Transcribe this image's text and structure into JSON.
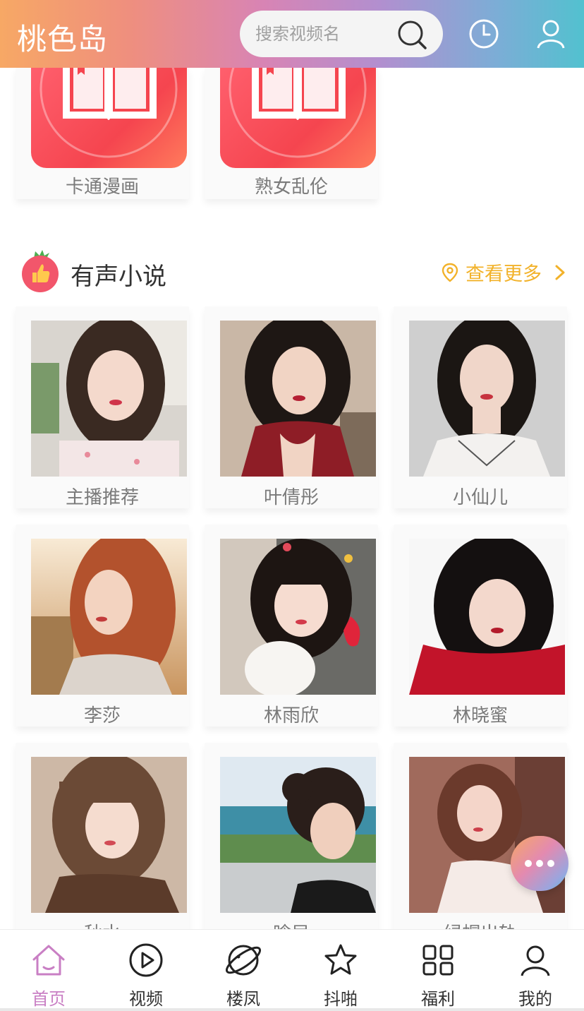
{
  "header": {
    "app_title": "桃色岛",
    "search_placeholder": "搜索视频名",
    "icons": [
      "search-icon",
      "history-clock-icon",
      "user-icon"
    ]
  },
  "categories": [
    {
      "label": "卡通漫画",
      "icon": "open-book-icon",
      "tile_color": "#f5454f"
    },
    {
      "label": "熟女乱伦",
      "icon": "open-book-icon",
      "tile_color": "#f5454f"
    }
  ],
  "section": {
    "title": "有声小说",
    "more_label": "查看更多",
    "icon": "strawberry-thumbs-up-icon",
    "accent_color": "#f2b22a"
  },
  "anchors": [
    {
      "name": "主播推荐"
    },
    {
      "name": "叶倩彤"
    },
    {
      "name": "小仙儿"
    },
    {
      "name": "李莎"
    },
    {
      "name": "林雨欣"
    },
    {
      "name": "林晓蜜"
    },
    {
      "name": "秋水"
    },
    {
      "name": "晗局"
    },
    {
      "name": "绿帽出轨"
    }
  ],
  "fab": {
    "icon": "more-dots-icon"
  },
  "bottom_nav": [
    {
      "label": "首页",
      "icon": "home-icon",
      "active": true
    },
    {
      "label": "视频",
      "icon": "play-circle-icon",
      "active": false
    },
    {
      "label": "楼凤",
      "icon": "planet-icon",
      "active": false
    },
    {
      "label": "抖啪",
      "icon": "star-icon",
      "active": false
    },
    {
      "label": "福利",
      "icon": "grid-icon",
      "active": false
    },
    {
      "label": "我的",
      "icon": "profile-icon",
      "active": false
    }
  ],
  "colors": {
    "active_nav": "#c97fc4",
    "label_gray": "#7a7a7a"
  }
}
